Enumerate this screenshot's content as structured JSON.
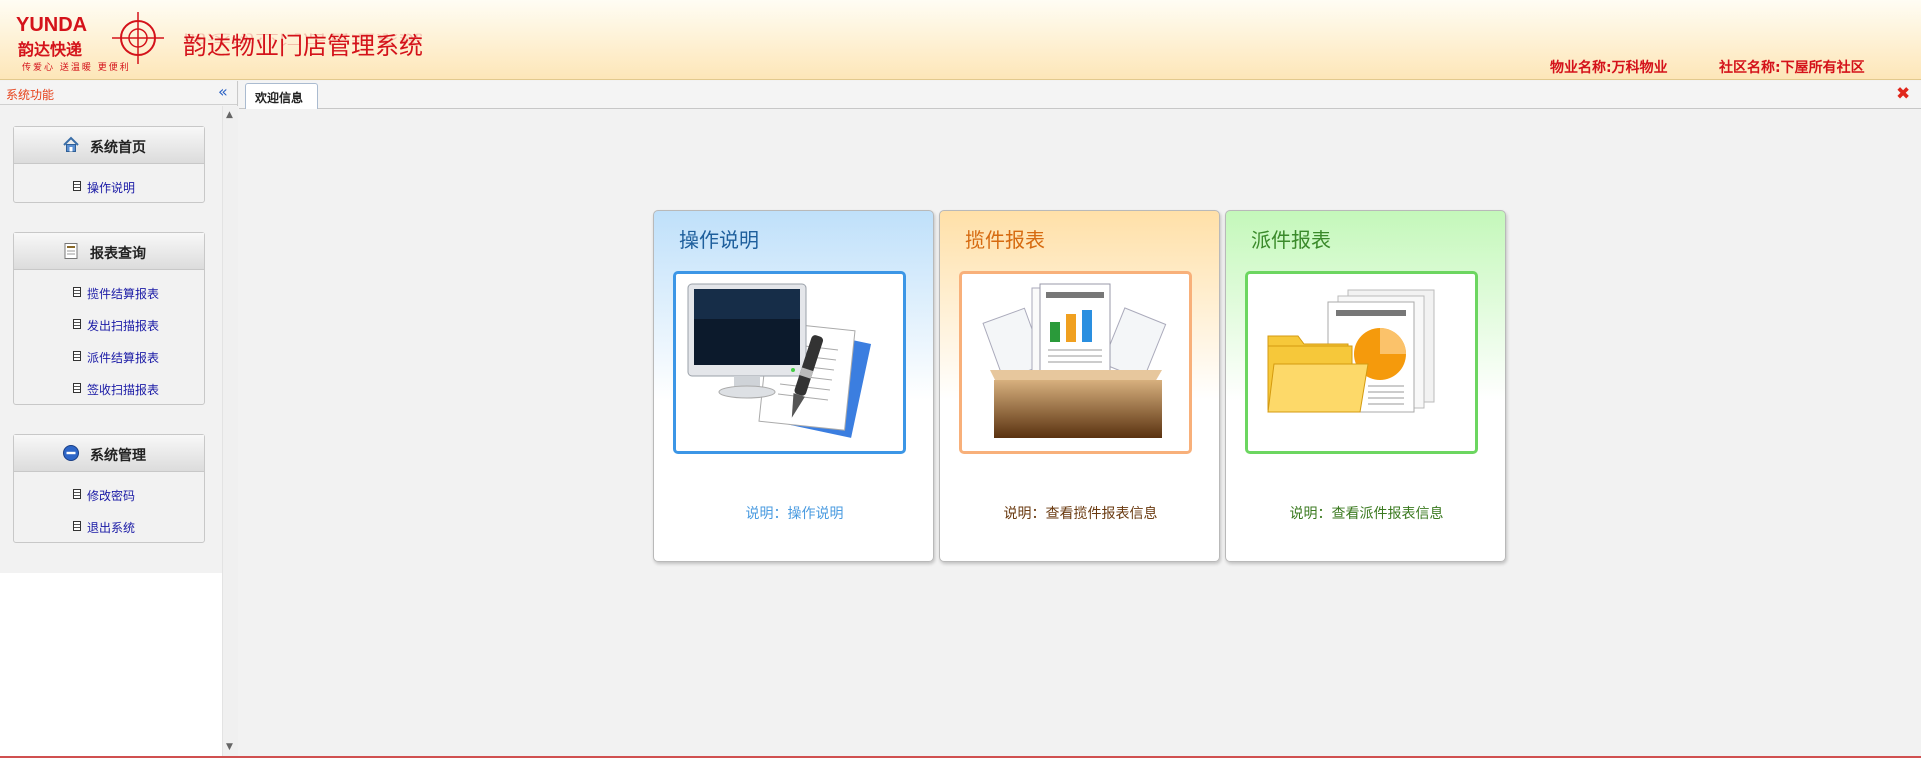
{
  "header": {
    "logo_word": "YUNDA",
    "logo_cn": "韵达快递",
    "logo_slogan": "传爱心 送温暖 更便利",
    "system_title": "韵达物业门店管理系统",
    "property_name": "物业名称:万科物业",
    "community_name": "社区名称:下屋所有社区"
  },
  "sidebar": {
    "title": "系统功能",
    "collapse_icon": "«",
    "panels": [
      {
        "title": "系统首页",
        "icon": "home-icon",
        "items": [
          {
            "label": "操作说明"
          }
        ]
      },
      {
        "title": "报表查询",
        "icon": "report-icon",
        "items": [
          {
            "label": "揽件结算报表"
          },
          {
            "label": "发出扫描报表"
          },
          {
            "label": "派件结算报表"
          },
          {
            "label": "签收扫描报表"
          }
        ]
      },
      {
        "title": "系统管理",
        "icon": "manage-icon",
        "items": [
          {
            "label": "修改密码"
          },
          {
            "label": "退出系统"
          }
        ]
      }
    ]
  },
  "tabs": [
    {
      "label": "欢迎信息",
      "active": true
    }
  ],
  "close_icon": "✖",
  "cards": [
    {
      "title": "操作说明",
      "description": "说明：操作说明",
      "icon": "computer-document-icon",
      "accent": "#3c96e6"
    },
    {
      "title": "揽件报表",
      "description": "说明：查看揽件报表信息",
      "icon": "report-box-icon",
      "accent": "#f8b07a"
    },
    {
      "title": "派件报表",
      "description": "说明：查看派件报表信息",
      "icon": "folder-chart-icon",
      "accent": "#6cd660"
    }
  ],
  "colors": {
    "brand_red": "#d4121a",
    "link_blue": "#1a1aa6"
  }
}
